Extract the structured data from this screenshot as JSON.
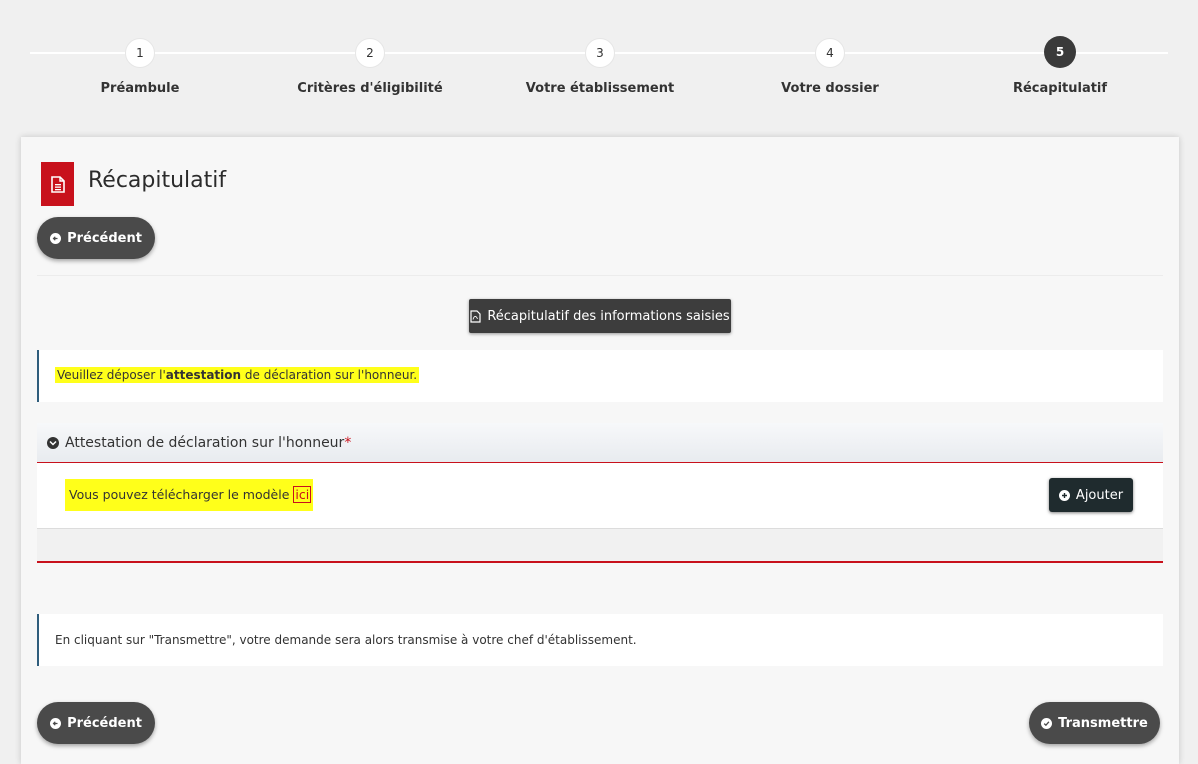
{
  "stepper": {
    "steps": [
      {
        "number": "1",
        "label": "Préambule"
      },
      {
        "number": "2",
        "label": "Critères d'éligibilité"
      },
      {
        "number": "3",
        "label": "Votre établissement"
      },
      {
        "number": "4",
        "label": "Votre dossier"
      },
      {
        "number": "5",
        "label": "Récapitulatif"
      }
    ],
    "active_index": 4
  },
  "page": {
    "title": "Récapitulatif",
    "previous_label": "Précédent",
    "recap_button_label": "Récapitulatif des informations saisies",
    "submit_label": "Transmettre"
  },
  "notice": {
    "prefix": "Veuillez déposer l'",
    "bold": "attestation",
    "suffix": " de déclaration sur l'honneur."
  },
  "attestation_section": {
    "title": "Attestation de déclaration sur l'honneur",
    "required_mark": "*",
    "download_text": "Vous pouvez télécharger le modèle ",
    "download_link": "ici",
    "add_label": "Ajouter"
  },
  "transmit_notice": {
    "text": "En cliquant sur \"Transmettre\", votre demande sera alors transmise à votre chef d'établissement."
  },
  "colors": {
    "brand_red": "#c8111c",
    "highlight": "#ffff1a",
    "dark_button": "#4a4a4a",
    "info_border": "#2f5d7c"
  }
}
